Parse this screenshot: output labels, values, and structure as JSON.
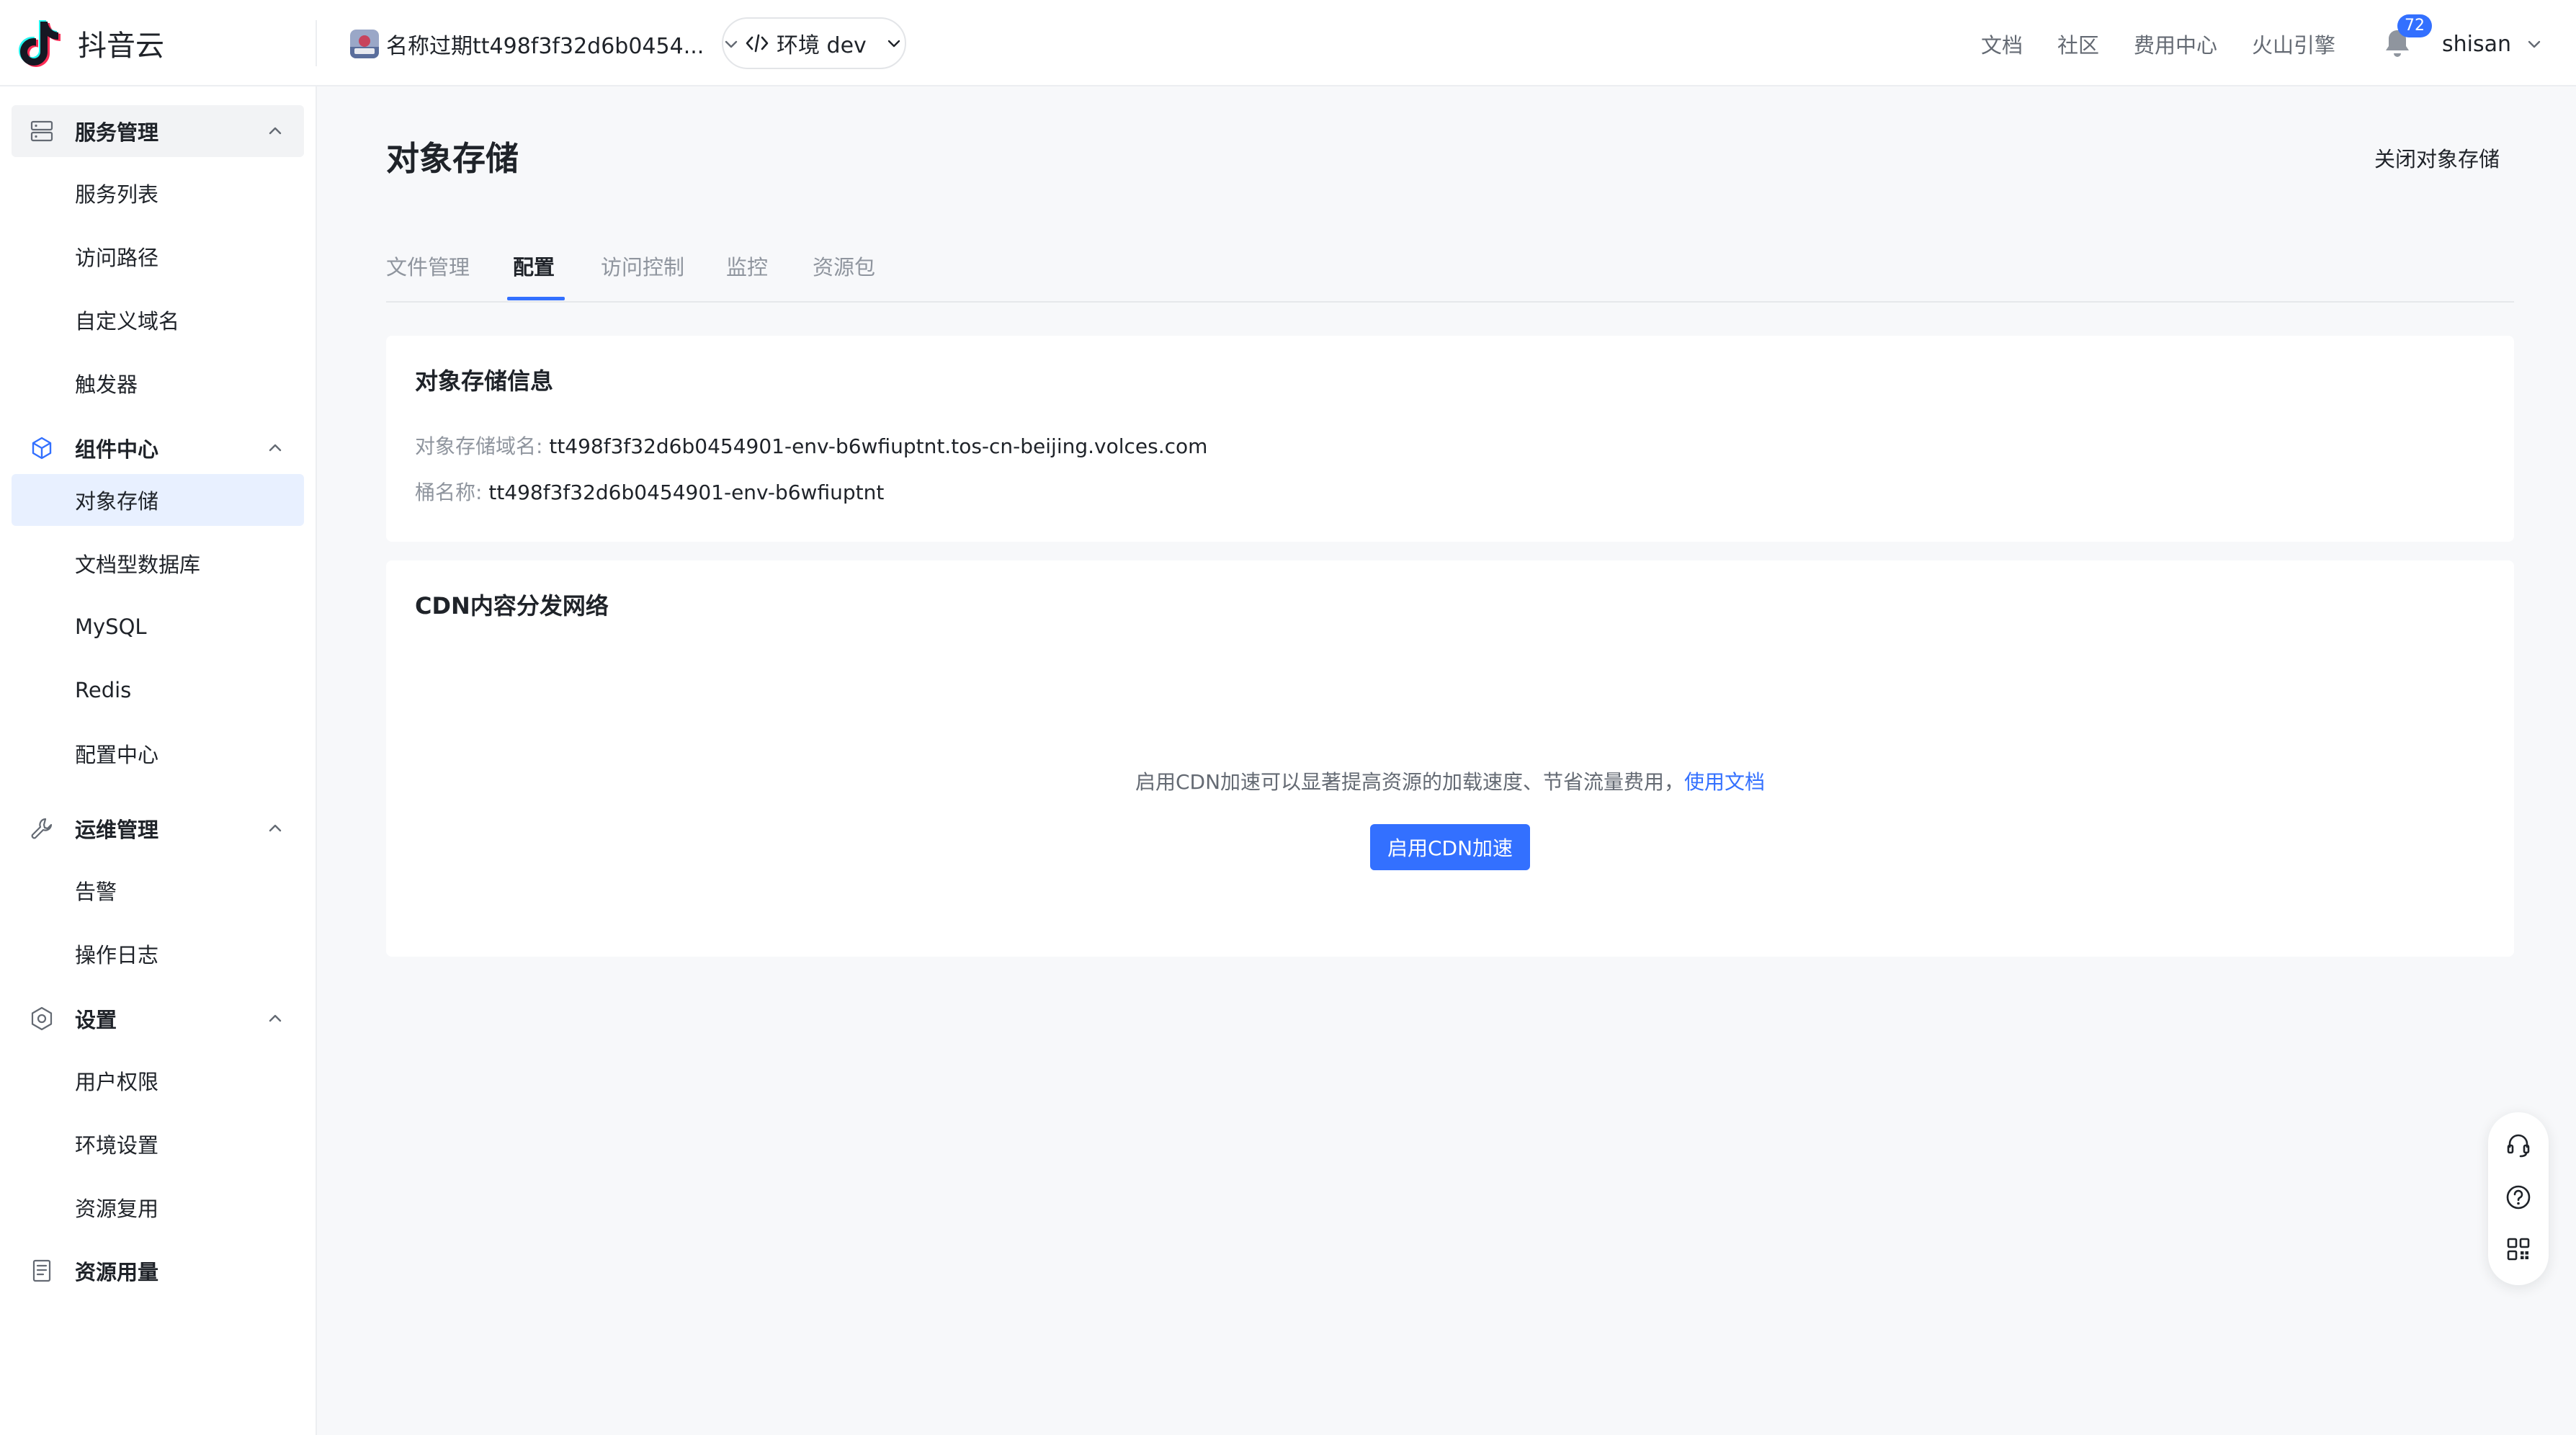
{
  "brand": {
    "name": "抖音云"
  },
  "header": {
    "project_name": "名称过期tt498f3f32d6b0454...",
    "env_label": "环境 dev",
    "nav": [
      "文档",
      "社区",
      "费用中心",
      "火山引擎"
    ],
    "notification_count": "72",
    "user_name": "shisan"
  },
  "sidebar": {
    "groups": [
      {
        "label": "服务管理",
        "icon": "server-icon",
        "items": [
          "服务列表",
          "访问路径",
          "自定义域名",
          "触发器"
        ]
      },
      {
        "label": "组件中心",
        "icon": "component-icon",
        "items": [
          "对象存储",
          "文档型数据库",
          "MySQL",
          "Redis",
          "配置中心"
        ]
      },
      {
        "label": "运维管理",
        "icon": "wrench-icon",
        "items": [
          "告警",
          "操作日志"
        ]
      },
      {
        "label": "设置",
        "icon": "settings-icon",
        "items": [
          "用户权限",
          "环境设置",
          "资源复用"
        ]
      },
      {
        "label": "资源用量",
        "icon": "document-icon",
        "items": []
      }
    ],
    "active_item": "对象存储"
  },
  "page": {
    "title": "对象存储",
    "close_link": "关闭对象存储",
    "tabs": [
      "文件管理",
      "配置",
      "访问控制",
      "监控",
      "资源包"
    ],
    "active_tab": "配置"
  },
  "info_card": {
    "title": "对象存储信息",
    "domain_label": "对象存储域名:",
    "domain_value": "tt498f3f32d6b0454901-env-b6wfiuptnt.tos-cn-beijing.volces.com",
    "bucket_label": "桶名称:",
    "bucket_value": "tt498f3f32d6b0454901-env-b6wfiuptnt"
  },
  "cdn_card": {
    "title": "CDN内容分发网络",
    "description": "启用CDN加速可以显著提高资源的加载速度、节省流量费用，",
    "doc_link": "使用文档",
    "enable_button": "启用CDN加速"
  },
  "colors": {
    "accent": "#3370ff",
    "active_bg": "#e8f0ff",
    "page_bg": "#f7f8fa"
  }
}
